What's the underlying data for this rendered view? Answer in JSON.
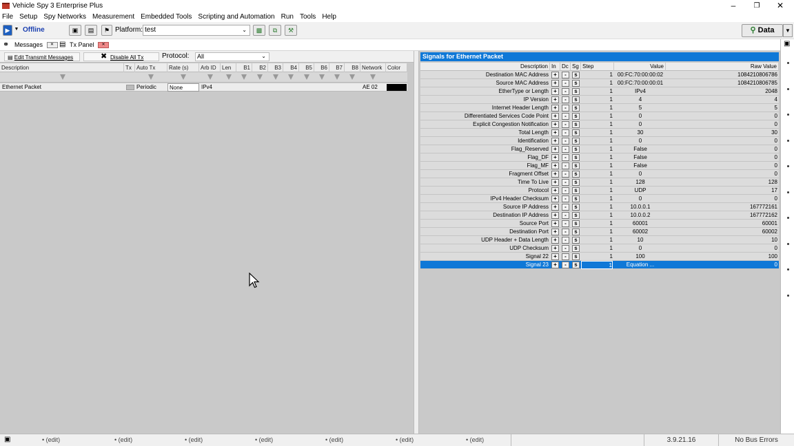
{
  "window": {
    "title": "Vehicle Spy 3 Enterprise Plus"
  },
  "menu": [
    "File",
    "Setup",
    "Spy Networks",
    "Measurement",
    "Embedded Tools",
    "Scripting and Automation",
    "Run",
    "Tools",
    "Help"
  ],
  "toolbar": {
    "status": "Offline",
    "platform_label": "Platform:",
    "platform_value": "test",
    "data_button": "Data"
  },
  "tabs": {
    "messages": "Messages",
    "tx_panel": "Tx Panel"
  },
  "left": {
    "edit_transmit": "Edit Transmit Messages",
    "disable_all": "Disable All Tx",
    "protocol_label": "Protocol:",
    "protocol_value": "All",
    "columns": [
      "Description",
      "Tx",
      "Auto Tx",
      "Rate (s)",
      "Arb ID",
      "Len",
      "B1",
      "B2",
      "B3",
      "B4",
      "B5",
      "B6",
      "B7",
      "B8",
      "Network",
      "Color"
    ],
    "row": {
      "description": "Ethernet Packet",
      "auto_tx": "Periodic",
      "rate": "None",
      "arb_id": "IPv4",
      "network": "AE 02"
    }
  },
  "signals": {
    "title": "Signals for Ethernet Packet",
    "columns": [
      "Description",
      "In",
      "Dc",
      "Sg",
      "Step",
      "Value",
      "Raw Value"
    ],
    "rows": [
      {
        "desc": "Destination MAC Address",
        "step": "1",
        "value": "00:FC:70:00:00:02",
        "raw": "1084210806786"
      },
      {
        "desc": "Source MAC Address",
        "step": "1",
        "value": "00:FC:70:00:00:01",
        "raw": "1084210806785"
      },
      {
        "desc": "EtherType or Length",
        "step": "1",
        "value": "IPv4",
        "raw": "2048"
      },
      {
        "desc": "IP Version",
        "step": "1",
        "value": "4",
        "raw": "4"
      },
      {
        "desc": "Internet Header Length",
        "step": "1",
        "value": "5",
        "raw": "5"
      },
      {
        "desc": "Differentiated Services Code Point",
        "step": "1",
        "value": "0",
        "raw": "0"
      },
      {
        "desc": "Explicit Congestion Notification",
        "step": "1",
        "value": "0",
        "raw": "0"
      },
      {
        "desc": "Total Length",
        "step": "1",
        "value": "30",
        "raw": "30"
      },
      {
        "desc": "Identification",
        "step": "1",
        "value": "0",
        "raw": "0"
      },
      {
        "desc": "Flag_Reserved",
        "step": "1",
        "value": "False",
        "raw": "0"
      },
      {
        "desc": "Flag_DF",
        "step": "1",
        "value": "False",
        "raw": "0"
      },
      {
        "desc": "Flag_MF",
        "step": "1",
        "value": "False",
        "raw": "0"
      },
      {
        "desc": "Fragment Offset",
        "step": "1",
        "value": "0",
        "raw": "0"
      },
      {
        "desc": "Time To Live",
        "step": "1",
        "value": "128",
        "raw": "128"
      },
      {
        "desc": "Protocol",
        "step": "1",
        "value": "UDP",
        "raw": "17"
      },
      {
        "desc": "IPv4 Header Checksum",
        "step": "1",
        "value": "0",
        "raw": "0"
      },
      {
        "desc": "Source IP Address",
        "step": "1",
        "value": "10.0.0.1",
        "raw": "167772161"
      },
      {
        "desc": "Destination IP Address",
        "step": "1",
        "value": "10.0.0.2",
        "raw": "167772162"
      },
      {
        "desc": "Source Port",
        "step": "1",
        "value": "60001",
        "raw": "60001"
      },
      {
        "desc": "Destination Port",
        "step": "1",
        "value": "60002",
        "raw": "60002"
      },
      {
        "desc": "UDP Header + Data Length",
        "step": "1",
        "value": "10",
        "raw": "10"
      },
      {
        "desc": "UDP Checksum",
        "step": "1",
        "value": "0",
        "raw": "0"
      },
      {
        "desc": "Signal 22",
        "step": "1",
        "value": "100",
        "raw": "100"
      },
      {
        "desc": "Signal 23",
        "step": "1",
        "value": "Equation ...",
        "raw": "0",
        "selected": true
      }
    ],
    "btn_in": "+",
    "btn_dc": "-",
    "btn_sg": "s"
  },
  "statusbar": {
    "edit_items": [
      "(edit)",
      "(edit)",
      "(edit)",
      "(edit)",
      "(edit)",
      "(edit)",
      "(edit)"
    ],
    "version": "3.9.21.16",
    "bus_status": "No Bus Errors"
  },
  "colors": {
    "accent": "#0f78d7",
    "offline": "#1a3fb0",
    "selection": "#0f78d7"
  }
}
